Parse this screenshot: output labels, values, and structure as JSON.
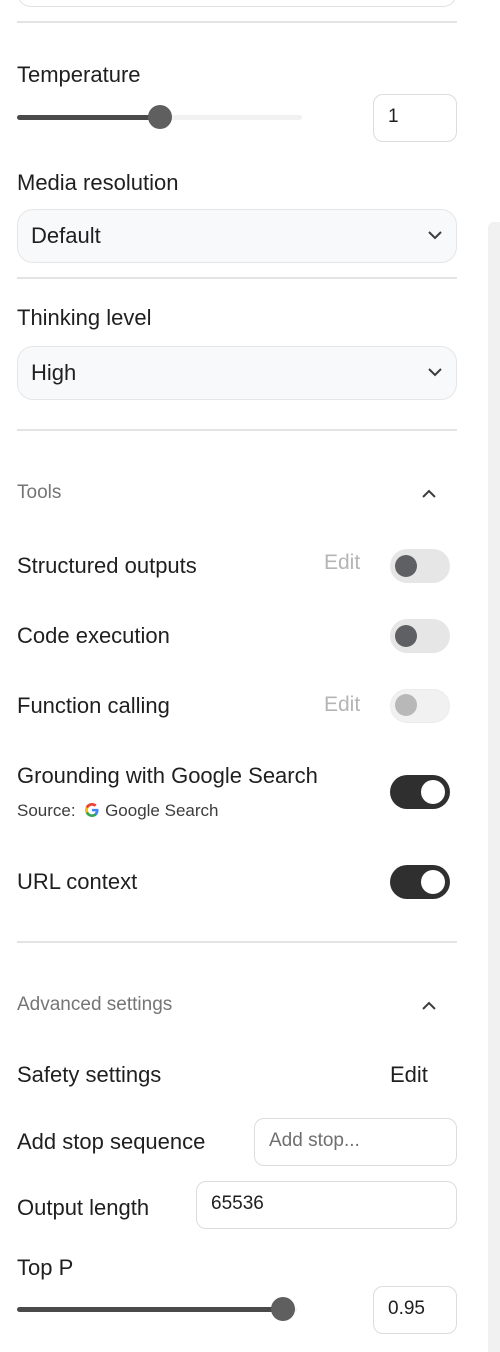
{
  "temperature": {
    "label": "Temperature",
    "value": "1",
    "level": 0.5
  },
  "media_resolution": {
    "label": "Media resolution",
    "selected": "Default"
  },
  "thinking_level": {
    "label": "Thinking level",
    "selected": "High"
  },
  "tools": {
    "title": "Tools",
    "items": [
      {
        "label": "Structured outputs",
        "edit": "Edit",
        "enabled": false
      },
      {
        "label": "Code execution",
        "enabled": false
      },
      {
        "label": "Function calling",
        "edit": "Edit",
        "enabled": false
      },
      {
        "label": "Grounding with Google Search",
        "source_prefix": "Source:",
        "source_name": "Google Search",
        "enabled": true
      },
      {
        "label": "URL context",
        "enabled": true
      }
    ]
  },
  "advanced": {
    "title": "Advanced settings",
    "safety": {
      "label": "Safety settings",
      "edit": "Edit"
    },
    "stop_sequence": {
      "label": "Add stop sequence",
      "placeholder": "Add stop..."
    },
    "output_length": {
      "label": "Output length",
      "value": "65536"
    },
    "top_p": {
      "label": "Top P",
      "value": "0.95",
      "level": 0.95
    }
  },
  "icons": {
    "collapse": "chevron-up-icon",
    "dropdown": "chevron-down-icon",
    "google": "google-g-icon"
  }
}
